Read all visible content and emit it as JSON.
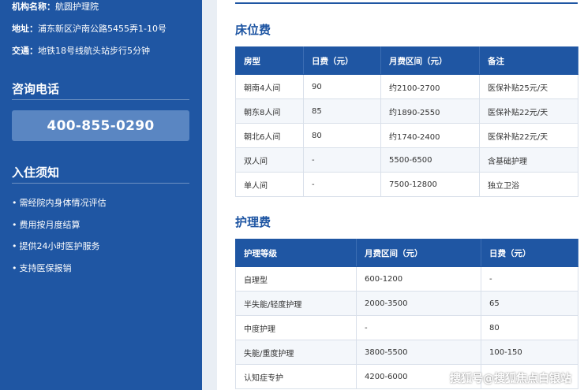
{
  "sidebar": {
    "info": [
      {
        "label": "机构名称：",
        "value": "航圆护理院"
      },
      {
        "label": "地址：",
        "value": "浦东新区沪南公路5455弄1-10号"
      },
      {
        "label": "交通：",
        "value": "地铁18号线航头站步行5分钟"
      }
    ],
    "phone_title": "咨询电话",
    "phone_number": "400-855-0290",
    "notes_title": "入住须知",
    "notes": [
      "需经院内身体情况评估",
      "费用按月度结算",
      "提供24小时医护服务",
      "支持医保报销"
    ],
    "bullet": "•"
  },
  "bed_fee": {
    "title": "床位费",
    "headers": [
      "房型",
      "日费（元）",
      "月费区间（元）",
      "备注"
    ],
    "rows": [
      [
        "朝南4人间",
        "90",
        "约2100-2700",
        "医保补贴25元/天"
      ],
      [
        "朝东8人间",
        "85",
        "约1890-2550",
        "医保补贴22元/天"
      ],
      [
        "朝北6人间",
        "80",
        "约1740-2400",
        "医保补贴22元/天"
      ],
      [
        "双人间",
        "-",
        "5500-6500",
        "含基础护理"
      ],
      [
        "单人间",
        "-",
        "7500-12800",
        "独立卫浴"
      ]
    ]
  },
  "care_fee": {
    "title": "护理费",
    "headers": [
      "护理等级",
      "月费区间（元）",
      "日费（元）"
    ],
    "rows": [
      [
        "自理型",
        "600-1200",
        "-"
      ],
      [
        "半失能/轻度护理",
        "2000-3500",
        "65"
      ],
      [
        "中度护理",
        "-",
        "80"
      ],
      [
        "失能/重度护理",
        "3800-5500",
        "100-150"
      ],
      [
        "认知症专护",
        "4200-6000",
        ""
      ]
    ]
  },
  "watermark": "搜狐号@搜狐焦点白银站",
  "colors": {
    "primary": "#1f56a3",
    "phone_box": "#5a86c2"
  }
}
